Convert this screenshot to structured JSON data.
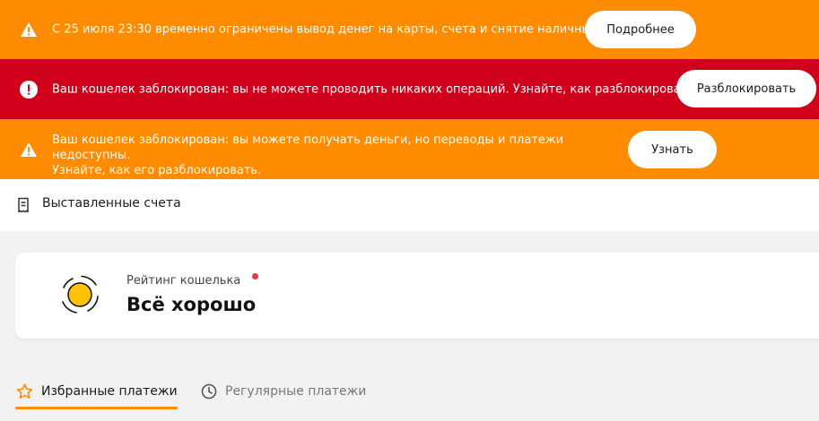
{
  "banners": [
    {
      "icon": "warning-triangle-icon",
      "text": "С 25 июля 23:30 временно ограничены вывод денег на карты, счета и снятие наличных",
      "button": "Подробнее",
      "color": "#ff8c00"
    },
    {
      "icon": "exclamation-circle-icon",
      "text": "Ваш кошелек заблокирован: вы не можете проводить никаких операций. Узнайте, как разблокировать",
      "button": "Разблокировать",
      "color": "#d0021b"
    },
    {
      "icon": "warning-triangle-icon",
      "text_line1": "Ваш кошелек заблокирован: вы можете получать деньги, но переводы и платежи недоступны.",
      "text_line2": "Узнайте, как его разблокировать.",
      "button": "Узнать",
      "color": "#ff8c00"
    }
  ],
  "invoices": {
    "icon": "receipt-icon",
    "label": "Выставленные счета"
  },
  "rating": {
    "icon": "rating-circle-icon",
    "label": "Рейтинг кошелька",
    "value": "Всё хорошо",
    "indicator_color": "#e8383d",
    "circle_color": "#ffc107"
  },
  "tabs": [
    {
      "icon": "star-icon",
      "label": "Избранные платежи",
      "active": true
    },
    {
      "icon": "clock-icon",
      "label": "Регулярные платежи",
      "active": false
    }
  ],
  "accent_color": "#ff8c00"
}
